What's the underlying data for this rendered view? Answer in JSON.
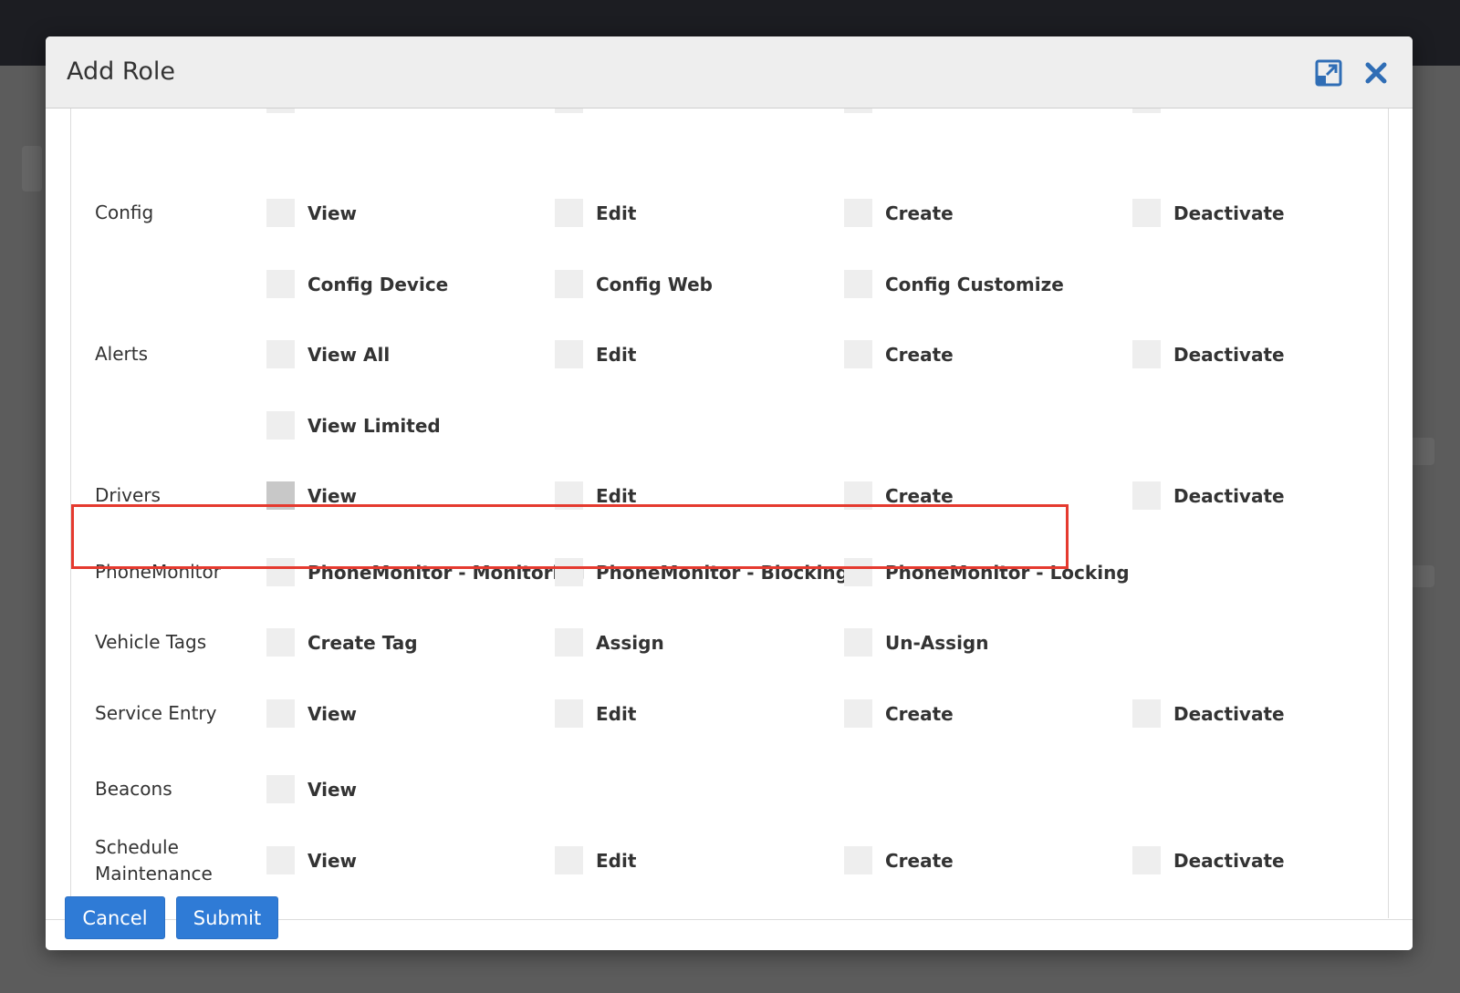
{
  "modal": {
    "title": "Add Role",
    "expand_icon": "expand-icon",
    "close_icon": "close-icon",
    "accent_color": "#2f6db5"
  },
  "permissions": [
    {
      "category": "Config",
      "options": [
        "View",
        "Edit",
        "Create",
        "Deactivate"
      ]
    },
    {
      "category": "",
      "options": [
        "Config Device",
        "Config Web",
        "Config Customize"
      ]
    },
    {
      "category": "Alerts",
      "options": [
        "View All",
        "Edit",
        "Create",
        "Deactivate"
      ]
    },
    {
      "category": "",
      "options": [
        "View Limited"
      ]
    },
    {
      "category": "Drivers",
      "options": [
        "View",
        "Edit",
        "Create",
        "Deactivate"
      ]
    },
    {
      "category": "PhoneMonitor",
      "options": [
        "PhoneMonitor - Monitoring",
        "PhoneMonitor - Blocking",
        "PhoneMonitor - Locking"
      ]
    },
    {
      "category": "Vehicle Tags",
      "options": [
        "Create Tag",
        "Assign",
        "Un-Assign"
      ]
    },
    {
      "category": "Service Entry",
      "options": [
        "View",
        "Edit",
        "Create",
        "Deactivate"
      ]
    },
    {
      "category": "Beacons",
      "options": [
        "View"
      ]
    },
    {
      "category": "Schedule Maintenance",
      "options": [
        "View",
        "Edit",
        "Create",
        "Deactivate"
      ]
    }
  ],
  "footer": {
    "cancel_label": "Cancel",
    "submit_label": "Submit",
    "button_color": "#2f7bd6"
  },
  "highlight_color": "#e53a2f"
}
